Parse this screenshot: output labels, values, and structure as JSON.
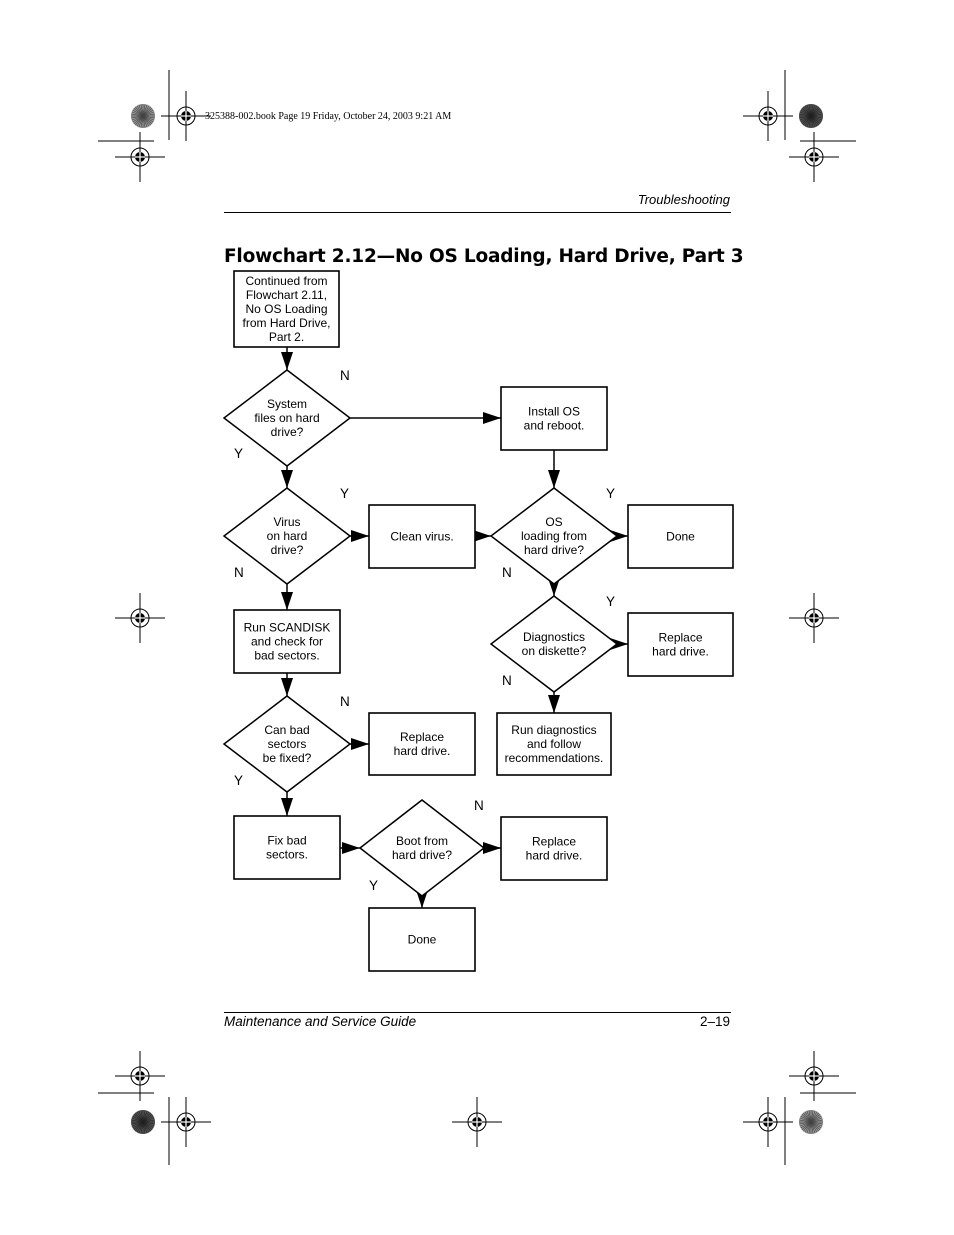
{
  "slug_line": "325388-002.book  Page 19  Friday, October 24, 2003  9:21 AM",
  "running_head": "Troubleshooting",
  "title": "Flowchart 2.12—No OS Loading, Hard Drive, Part 3",
  "footer": {
    "left": "Maintenance and Service Guide",
    "right": "2–19"
  },
  "flowchart": {
    "nodes": [
      {
        "id": "start",
        "type": "process",
        "lines": [
          "Continued from",
          "Flowchart 2.11,",
          "No OS Loading",
          "from Hard Drive,",
          "Part 2."
        ]
      },
      {
        "id": "sysfiles",
        "type": "decision",
        "lines": [
          "System",
          "files on hard",
          "drive?"
        ]
      },
      {
        "id": "installos",
        "type": "process",
        "lines": [
          "Install OS",
          "and reboot."
        ]
      },
      {
        "id": "virus",
        "type": "decision",
        "lines": [
          "Virus",
          "on hard",
          "drive?"
        ]
      },
      {
        "id": "cleanvirus",
        "type": "process",
        "lines": [
          "Clean virus."
        ]
      },
      {
        "id": "osloading",
        "type": "decision",
        "lines": [
          "OS",
          "loading from",
          "hard drive?"
        ]
      },
      {
        "id": "done1",
        "type": "process",
        "lines": [
          "Done"
        ]
      },
      {
        "id": "scandisk",
        "type": "process",
        "lines": [
          "Run SCANDISK",
          "and check for",
          "bad sectors."
        ]
      },
      {
        "id": "diagdisk",
        "type": "decision",
        "lines": [
          "Diagnostics",
          "on diskette?"
        ]
      },
      {
        "id": "replace1",
        "type": "process",
        "lines": [
          "Replace",
          "hard drive."
        ]
      },
      {
        "id": "badsectors",
        "type": "decision",
        "lines": [
          "Can bad",
          "sectors",
          "be fixed?"
        ]
      },
      {
        "id": "replace2",
        "type": "process",
        "lines": [
          "Replace",
          "hard drive."
        ]
      },
      {
        "id": "rundiag",
        "type": "process",
        "lines": [
          "Run diagnostics",
          "and follow",
          "recommendations."
        ]
      },
      {
        "id": "fixbad",
        "type": "process",
        "lines": [
          "Fix bad",
          "sectors."
        ]
      },
      {
        "id": "bootfrom",
        "type": "decision",
        "lines": [
          "Boot from",
          "hard drive?"
        ]
      },
      {
        "id": "replace3",
        "type": "process",
        "lines": [
          "Replace",
          "hard drive."
        ]
      },
      {
        "id": "done2",
        "type": "process",
        "lines": [
          "Done"
        ]
      }
    ],
    "edges": [
      {
        "from": "start",
        "to": "sysfiles",
        "label": ""
      },
      {
        "from": "sysfiles",
        "to": "installos",
        "label": "N"
      },
      {
        "from": "sysfiles",
        "to": "virus",
        "label": "Y"
      },
      {
        "from": "installos",
        "to": "osloading",
        "label": ""
      },
      {
        "from": "virus",
        "to": "cleanvirus",
        "label": "Y"
      },
      {
        "from": "virus",
        "to": "scandisk",
        "label": "N"
      },
      {
        "from": "cleanvirus",
        "to": "osloading",
        "label": ""
      },
      {
        "from": "osloading",
        "to": "done1",
        "label": "Y"
      },
      {
        "from": "osloading",
        "to": "diagdisk",
        "label": "N"
      },
      {
        "from": "diagdisk",
        "to": "replace1",
        "label": "Y"
      },
      {
        "from": "diagdisk",
        "to": "rundiag",
        "label": "N"
      },
      {
        "from": "scandisk",
        "to": "badsectors",
        "label": ""
      },
      {
        "from": "badsectors",
        "to": "replace2",
        "label": "N"
      },
      {
        "from": "badsectors",
        "to": "fixbad",
        "label": "Y"
      },
      {
        "from": "fixbad",
        "to": "bootfrom",
        "label": ""
      },
      {
        "from": "bootfrom",
        "to": "replace3",
        "label": "N"
      },
      {
        "from": "bootfrom",
        "to": "done2",
        "label": "Y"
      }
    ]
  }
}
